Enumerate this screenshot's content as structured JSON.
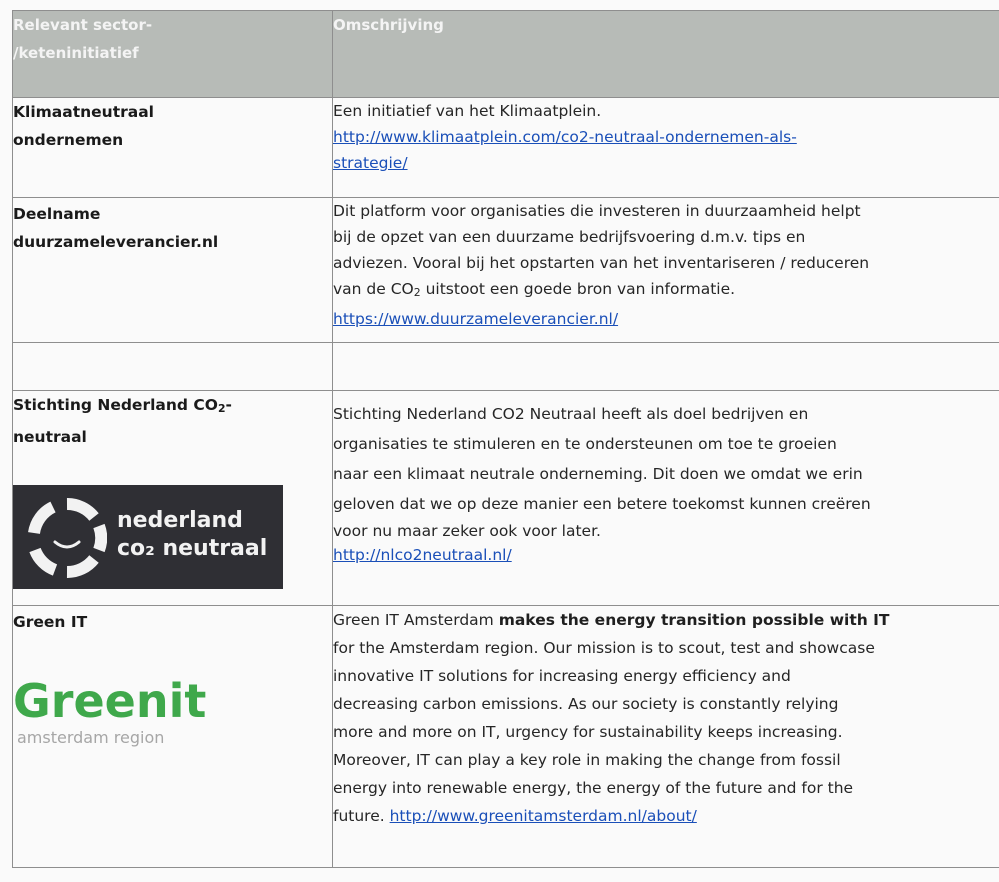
{
  "header": {
    "col1_line1": "Relevant sector-",
    "col1_line2": "/keteninitiatief",
    "col2": "Omschrijving"
  },
  "rows": [
    {
      "name_line1": "Klimaatneutraal",
      "name_line2": "ondernemen",
      "text": "Een initiatief van het Klimaatplein.",
      "link_line1": "http://www.klimaatplein.com/co2-neutraal-ondernemen-als-",
      "link_line2": "strategie/"
    },
    {
      "name_line1": "Deelname",
      "name_line2": "duurzameleverancier.nl",
      "text_line1": "Dit platform voor organisaties die investeren in duurzaamheid helpt",
      "text_line2": "bij de opzet van een duurzame bedrijfsvoering d.m.v. tips en",
      "text_line3": "adviezen. Vooral bij het opstarten van het inventariseren / reduceren",
      "text_line4_pre": "van de CO",
      "text_line4_sub": "2",
      "text_line4_post": " uitstoot een goede bron van informatie.",
      "link": "https://www.duurzameleverancier.nl/"
    },
    {
      "name_pre": "Stichting Nederland CO",
      "name_sub": "2",
      "name_post": "-",
      "name_line2": "neutraal",
      "text_line1": "Stichting Nederland CO2 Neutraal heeft als doel bedrijven en",
      "text_line2": "organisaties te stimuleren en te ondersteunen om toe te groeien",
      "text_line3": "naar een klimaat neutrale onderneming. Dit doen we omdat we erin",
      "text_line4": "geloven dat we op deze manier een betere toekomst kunnen creëren",
      "text_line5": "voor nu maar zeker ook voor later.",
      "link": "http://nlco2neutraal.nl/",
      "logo_line1": "nederland",
      "logo_line2": "co₂ neutraal"
    },
    {
      "name": "Green IT",
      "text_l1_pre": "Green IT Amsterdam ",
      "text_l1_bold": "makes the energy transition possible with IT",
      "text_l2": "for the Amsterdam region. Our mission is to scout, test and showcase",
      "text_l3": "innovative IT solutions for increasing energy efficiency and",
      "text_l4": "decreasing carbon emissions. As our society is constantly relying",
      "text_l5": "more and more on IT, urgency for sustainability keeps increasing.",
      "text_l6": "Moreover, IT can play a key role in making the change from fossil",
      "text_l7": "energy into renewable energy, the energy of the future and for the",
      "text_l8": "future. ",
      "link": "http://www.greenitamsterdam.nl/about/",
      "logo_main": "Greenit",
      "logo_sub": "amsterdam region"
    }
  ],
  "colors": {
    "header_bg": "#b7bbb7",
    "link": "#1a4fb8",
    "green_logo": "#3fa84b",
    "nl_logo_bg": "#2f2f34"
  }
}
